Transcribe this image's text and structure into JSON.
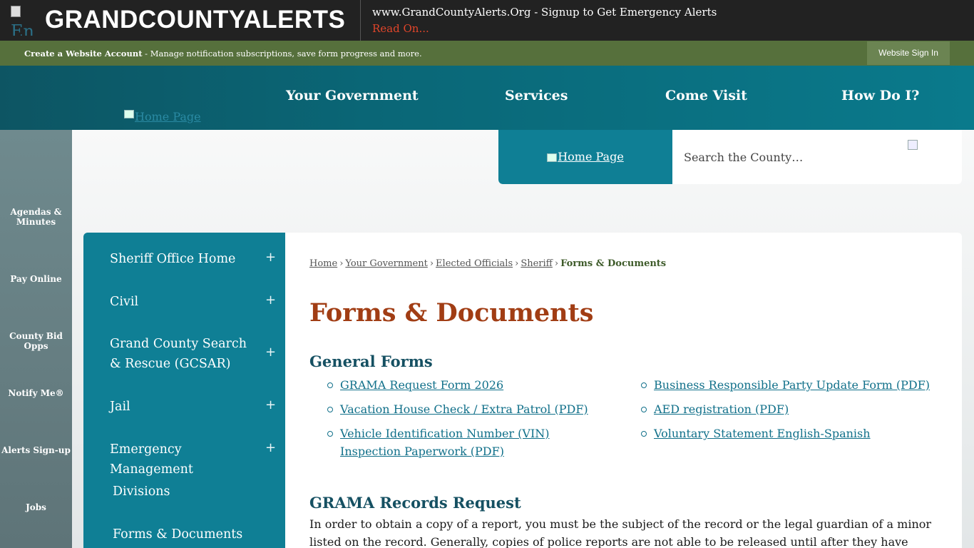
{
  "alert": {
    "logo_alt": "En",
    "name": "GRANDCOUNTYALERTS",
    "message": "www.GrandCountyAlerts.Org - Signup to Get Emergency Alerts",
    "read_on": "Read On..."
  },
  "account": {
    "bold": "Create a Website Account",
    "rest": " - Manage notification subscriptions, save form progress and more.",
    "sign_in": "Website Sign In"
  },
  "nav": {
    "home_alt": "Home Page",
    "items": [
      "Your Government",
      "Services",
      "Come Visit",
      "How Do I?"
    ]
  },
  "rail": [
    "Agendas & Minutes",
    "Pay Online",
    "County Bid Opps",
    "Notify Me®",
    "Alerts Sign-up",
    "Jobs"
  ],
  "search": {
    "logo_alt": "Home Page",
    "placeholder": "Search the County…"
  },
  "sidenav": [
    {
      "label": "Sheriff Office Home",
      "expand": "+"
    },
    {
      "label": "Civil",
      "expand": "+"
    },
    {
      "label": "Grand County Search & Rescue (GCSAR)",
      "expand": "+"
    },
    {
      "label": "Jail",
      "expand": "+"
    },
    {
      "label": "Emergency Management",
      "expand": "+"
    },
    {
      "label": "Divisions",
      "expand": ""
    },
    {
      "label": "Forms & Documents",
      "expand": ""
    }
  ],
  "breadcrumb": {
    "items": [
      "Home",
      "Your Government",
      "Elected Officials",
      "Sheriff"
    ],
    "sep": "›",
    "current": "Forms & Documents"
  },
  "page_title": "Forms & Documents",
  "general_forms": {
    "heading": "General Forms",
    "left": [
      "GRAMA Request Form 2026",
      "Vacation House Check / Extra Patrol (PDF)",
      "Vehicle Identification Number (VIN) Inspection Paperwork (PDF)"
    ],
    "right": [
      "Business Responsible Party Update Form (PDF)",
      "AED registration (PDF)",
      "Voluntary Statement English-Spanish"
    ]
  },
  "grama": {
    "heading": "GRAMA Records Request",
    "text": "In order to obtain a copy of a report, you must be the subject of the record or the legal guardian of a minor listed on the record. Generally, copies of police reports are not able to be released until after they have been adjudicated, or processed through court."
  }
}
